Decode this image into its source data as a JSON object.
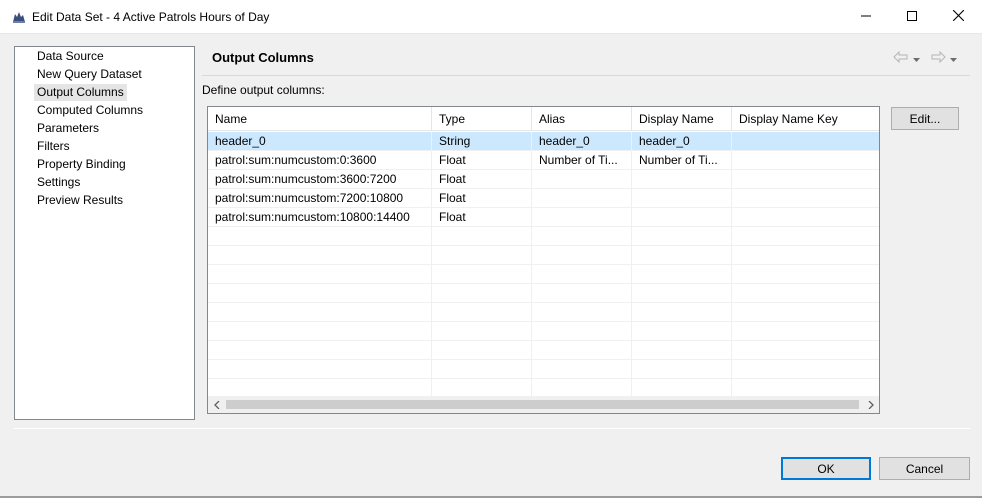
{
  "window": {
    "title": "Edit Data Set - 4 Active Patrols Hours of Day",
    "app_icon": "birt-dataset-icon",
    "controls": [
      "minimize-icon",
      "maximize-icon",
      "close-icon"
    ]
  },
  "nav": {
    "items": [
      {
        "label": "Data Source",
        "selected": false
      },
      {
        "label": "New Query Dataset",
        "selected": false
      },
      {
        "label": "Output Columns",
        "selected": true
      },
      {
        "label": "Computed Columns",
        "selected": false
      },
      {
        "label": "Parameters",
        "selected": false
      },
      {
        "label": "Filters",
        "selected": false
      },
      {
        "label": "Property Binding",
        "selected": false
      },
      {
        "label": "Settings",
        "selected": false
      },
      {
        "label": "Preview Results",
        "selected": false
      }
    ]
  },
  "page": {
    "title": "Output Columns",
    "description": "Define output columns:",
    "history": [
      "back-arrow-icon",
      "forward-arrow-icon"
    ]
  },
  "table": {
    "columns": [
      "Name",
      "Type",
      "Alias",
      "Display Name",
      "Display Name Key"
    ],
    "rows": [
      {
        "name": "header_0",
        "type": "String",
        "alias": "header_0",
        "display_name": "header_0",
        "display_name_key": "",
        "selected": true
      },
      {
        "name": "patrol:sum:numcustom:0:3600",
        "type": "Float",
        "alias": "Number of Ti...",
        "display_name": "Number of Ti...",
        "display_name_key": "",
        "selected": false
      },
      {
        "name": "patrol:sum:numcustom:3600:7200",
        "type": "Float",
        "alias": "",
        "display_name": "",
        "display_name_key": "",
        "selected": false
      },
      {
        "name": "patrol:sum:numcustom:7200:10800",
        "type": "Float",
        "alias": "",
        "display_name": "",
        "display_name_key": "",
        "selected": false
      },
      {
        "name": "patrol:sum:numcustom:10800:14400",
        "type": "Float",
        "alias": "",
        "display_name": "",
        "display_name_key": "",
        "selected": false
      }
    ]
  },
  "buttons": {
    "edit": "Edit...",
    "ok": "OK",
    "cancel": "Cancel"
  },
  "colors": {
    "selection": "#cce8ff",
    "nav_selection": "#e5e5e5",
    "default_button_border": "#0078d7"
  }
}
